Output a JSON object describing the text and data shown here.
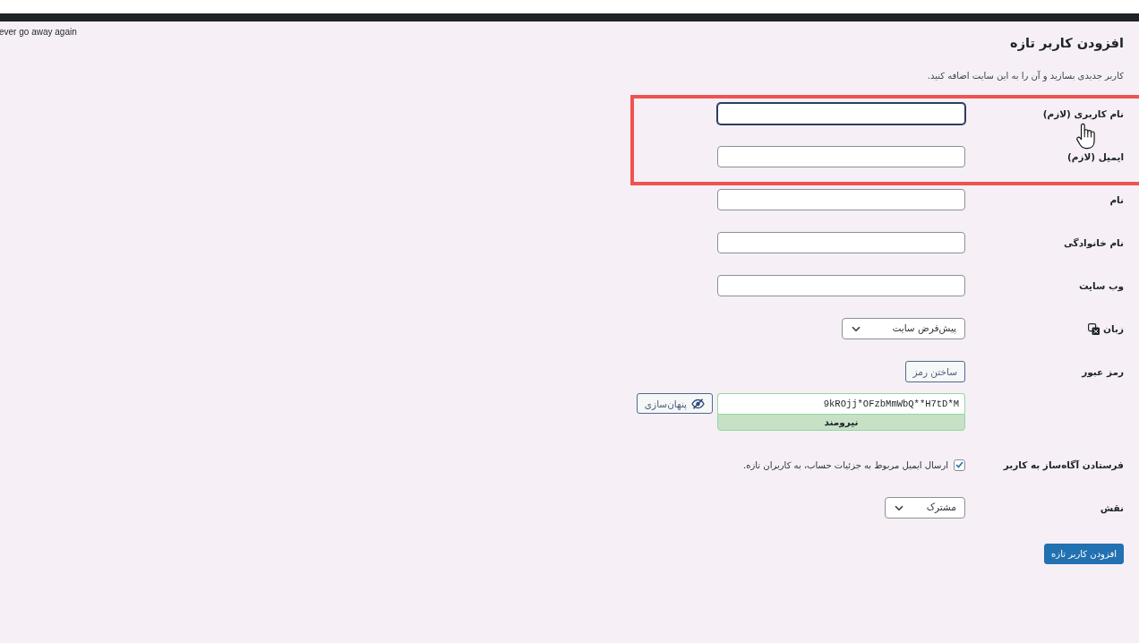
{
  "notice_fragment": "ever go away again",
  "heading": "افزودن کاربر تازه",
  "description": "کاربر جدیدی بسازید و آن را به این سایت اضافه کنید.",
  "fields": [
    {
      "kind": "text",
      "label": "نام کاربری (لازم)",
      "focused": true,
      "highlighted": true
    },
    {
      "kind": "text",
      "label": "ایمیل (لازم)",
      "focused": false,
      "highlighted": true
    },
    {
      "kind": "text",
      "label": "نام",
      "focused": false,
      "highlighted": false
    },
    {
      "kind": "text",
      "label": "نام خانوادگی",
      "focused": false,
      "highlighted": false
    },
    {
      "kind": "text",
      "label": "وب سایت",
      "focused": false,
      "highlighted": false
    },
    {
      "kind": "language",
      "label": "زبان",
      "value": "پیش‌فرض سایت",
      "highlighted": false
    },
    {
      "kind": "password",
      "label": "رمز عبور",
      "generate_button": "ساختن رمز",
      "value": "9kROjj*OFzbMmWbQ**H7tD*M",
      "strength": "نیرومند",
      "toggle_button": "پنهان‌سازی",
      "highlighted": false
    },
    {
      "kind": "checkbox",
      "label": "فرستادن آگاه‌ساز به کاربر",
      "checked": true,
      "text": "ارسال ایمیل مربوط به جزئیات حساب، به کاربران تازه.",
      "highlighted": false
    },
    {
      "kind": "select",
      "label": "نقش",
      "value": "مشترک",
      "highlighted": false
    }
  ],
  "submit_button": "افزودن کاربر تازه"
}
